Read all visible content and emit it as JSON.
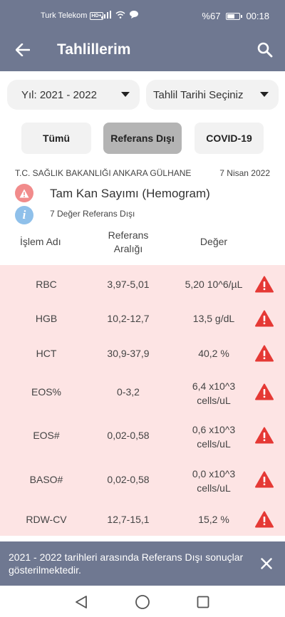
{
  "status_bar": {
    "carrier": "Turk Telekom",
    "network_badge": "HD+",
    "battery": "%67",
    "battery_level": 0.67,
    "time": "00:18"
  },
  "app_bar": {
    "title": "Tahlillerim",
    "back_icon": "arrow-left-icon",
    "search_icon": "search-icon"
  },
  "filters": {
    "year_dropdown": "Yıl: 2021 - 2022",
    "date_dropdown": "Tahlil Tarihi Seçiniz",
    "buttons": [
      "Tümü",
      "Referans Dışı",
      "COVID-19"
    ],
    "selected": "Referans Dışı"
  },
  "report": {
    "institution": "T.C. SAĞLIK BAKANLIĞI ANKARA GÜLHANE",
    "date": "7 Nisan 2022",
    "test_name": "Tam Kan Sayımı (Hemogram)",
    "out_of_range_count": "7 Değer Referans Dışı",
    "info_glyph": "i"
  },
  "table": {
    "headers": {
      "name": "İşlem Adı",
      "range_line1": "Referans",
      "range_line2": "Aralığı",
      "value": "Değer"
    },
    "rows": [
      {
        "name": "RBC",
        "range": "3,97-5,01",
        "value_line1": "5,20 10^6/µL",
        "value_line2": ""
      },
      {
        "name": "HGB",
        "range": "10,2-12,7",
        "value_line1": "13,5 g/dL",
        "value_line2": ""
      },
      {
        "name": "HCT",
        "range": "30,9-37,9",
        "value_line1": "40,2 %",
        "value_line2": ""
      },
      {
        "name": "EOS%",
        "range": "0-3,2",
        "value_line1": "6,4 x10^3",
        "value_line2": "cells/uL"
      },
      {
        "name": "EOS#",
        "range": "0,02-0,58",
        "value_line1": "0,6 x10^3",
        "value_line2": "cells/uL"
      },
      {
        "name": "BASO#",
        "range": "0,02-0,58",
        "value_line1": "0,0 x10^3",
        "value_line2": "cells/uL"
      },
      {
        "name": "RDW-CV",
        "range": "12,7-15,1",
        "value_line1": "15,2 %",
        "value_line2": ""
      }
    ]
  },
  "toast": {
    "message": "2021 - 2022 tarihleri arasında Referans Dışı sonuçlar gösterilmektedir.",
    "close_icon": "close-icon"
  },
  "colors": {
    "primary": "#6f7891",
    "alert_red": "#e53935",
    "row_bg": "#fde4e4",
    "selected_filter": "#b4b4b4"
  }
}
